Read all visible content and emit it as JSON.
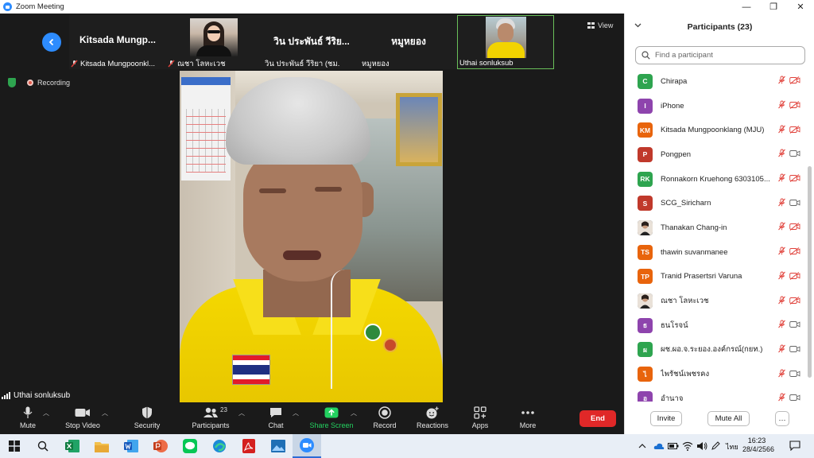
{
  "window": {
    "title": "Zoom Meeting",
    "minimize_label": "—",
    "restore_label": "❐",
    "close_label": "✕"
  },
  "strip": {
    "thumbnails": [
      {
        "big_name": "Kitsada  Mungp...",
        "label": "Kitsada Mungpoonkl..."
      },
      {
        "big_name": "",
        "label": "ณชา โลหะเวช"
      },
      {
        "big_name": "วิน ประพันธ์ วีริย...",
        "label": "วิน ประพันธ์ วีริยา (ชม."
      },
      {
        "big_name": "หมูหยอง",
        "label": "หมูหยอง"
      },
      {
        "big_name": "",
        "label": "Uthai sonluksub"
      }
    ],
    "view_label": "View"
  },
  "status": {
    "recording_label": "Recording"
  },
  "speaker": {
    "name": "Uthai sonluksub"
  },
  "toolbar": {
    "mute": "Mute",
    "stop_video": "Stop Video",
    "security": "Security",
    "participants": "Participants",
    "participants_count": "23",
    "chat": "Chat",
    "share_screen": "Share Screen",
    "record": "Record",
    "reactions": "Reactions",
    "apps": "Apps",
    "more": "More",
    "end": "End"
  },
  "panel": {
    "title": "Participants (23)",
    "search_placeholder": "Find a participant",
    "participants": [
      {
        "initials": "C",
        "name": "Chirapa",
        "color": "#2ea44f",
        "cam_off": true
      },
      {
        "initials": "I",
        "name": "iPhone",
        "color": "#8e44ad",
        "cam_off": true
      },
      {
        "initials": "KM",
        "name": "Kitsada Mungpoonklang (MJU)",
        "color": "#e8640c",
        "cam_off": true
      },
      {
        "initials": "P",
        "name": "Pongpen",
        "color": "#c0392b",
        "cam_off": false
      },
      {
        "initials": "RK",
        "name": "Ronnakorn Kruehong  6303105...",
        "color": "#2ea44f",
        "cam_off": true
      },
      {
        "initials": "S",
        "name": "SCG_Siricharn",
        "color": "#c0392b",
        "cam_off": false
      },
      {
        "initials": "",
        "name": "Thanakan Chang-in",
        "color": "#333333",
        "cam_off": true
      },
      {
        "initials": "TS",
        "name": "thawin suvanmanee",
        "color": "#e8640c",
        "cam_off": true
      },
      {
        "initials": "TP",
        "name": "Tranid Prasertsri Varuna",
        "color": "#e8640c",
        "cam_off": true
      },
      {
        "initials": "",
        "name": "ณชา โลหะเวช",
        "color": "#555555",
        "cam_off": true
      },
      {
        "initials": "ธ",
        "name": "ธนโรจน์",
        "color": "#8e44ad",
        "cam_off": false
      },
      {
        "initials": "ผ",
        "name": "ผช.ผอ.จ.ระยอง.องค์กรณ์(กยท.)",
        "color": "#2ea44f",
        "cam_off": false
      },
      {
        "initials": "ไ",
        "name": "ไพรัชน์เพชรคง",
        "color": "#e8640c",
        "cam_off": false
      },
      {
        "initials": "อ",
        "name": "อำนาจ",
        "color": "#8e44ad",
        "cam_off": false
      }
    ],
    "invite": "Invite",
    "mute_all": "Mute All",
    "more": "…"
  },
  "taskbar": {
    "time": "16:23",
    "date": "28/4/2566",
    "lang": "ไทย"
  },
  "colors": {
    "accent": "#2d8cff",
    "end": "#e02828",
    "share_green": "#23d160",
    "muted_red": "#e0413a"
  },
  "icons": [
    "zoom-icon",
    "back-chevron-icon",
    "mic-off-icon",
    "grid-view-icon",
    "shield-icon",
    "record-dot-icon",
    "mic-icon",
    "video-icon",
    "security-shield-icon",
    "participants-icon",
    "chat-icon",
    "share-screen-icon",
    "record-icon",
    "reactions-icon",
    "apps-icon",
    "more-icon",
    "search-icon",
    "cam-off-icon",
    "windows-start-icon",
    "taskbar-search-icon"
  ]
}
